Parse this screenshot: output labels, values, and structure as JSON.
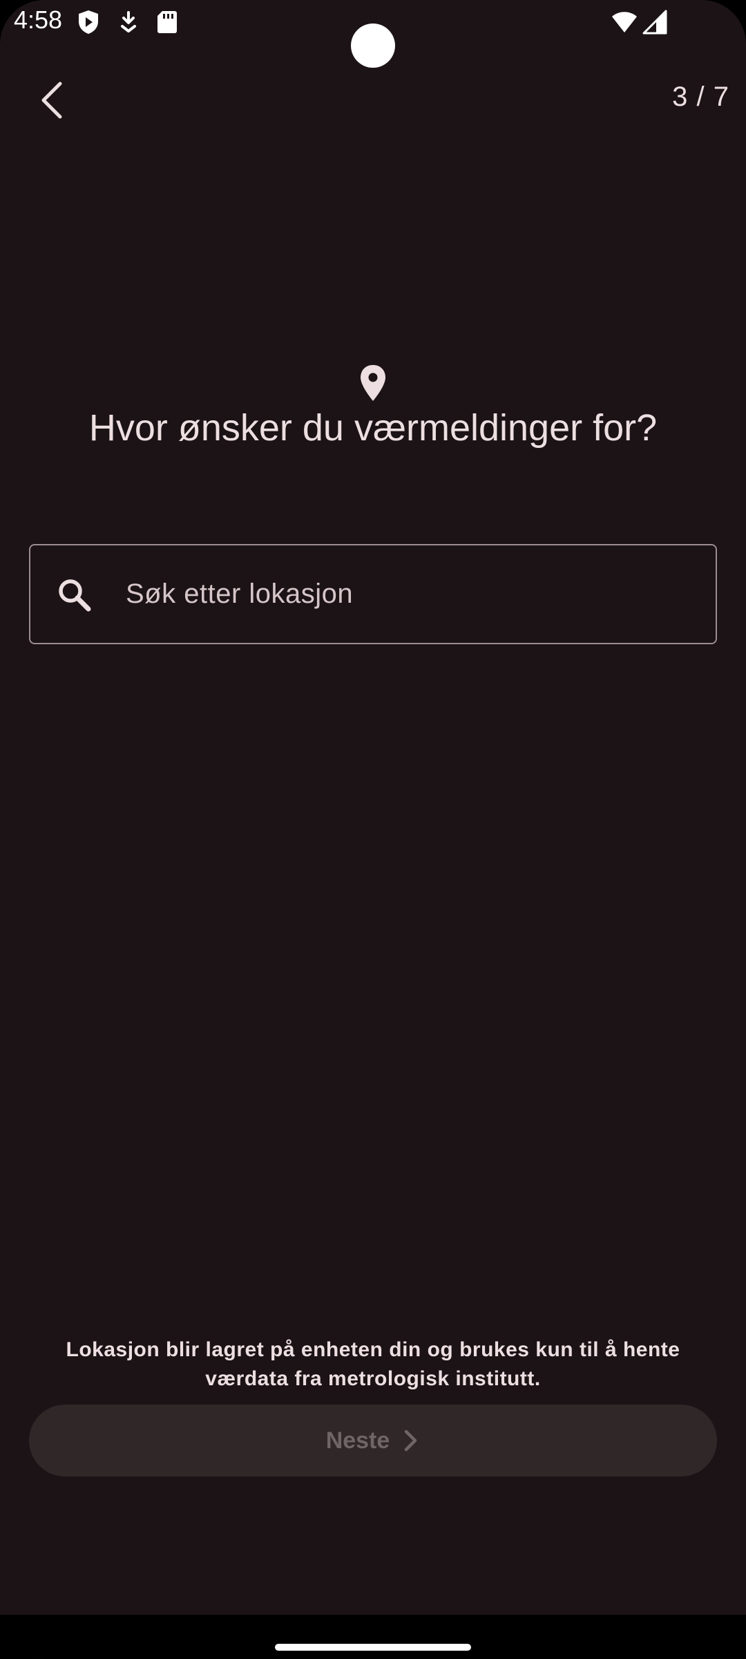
{
  "status_bar": {
    "time": "4:58",
    "left_icons": [
      "shield-play-icon",
      "download-icon",
      "sd-card-icon"
    ],
    "right_icons": [
      "wifi-icon",
      "signal-icon"
    ]
  },
  "header": {
    "back_icon": "chevron-left-icon",
    "step": "3 / 7"
  },
  "main": {
    "icon": "location-pin-icon",
    "title": "Hvor ønsker du værmeldinger for?",
    "search": {
      "icon": "search-icon",
      "placeholder": "Søk etter lokasjon",
      "value": ""
    }
  },
  "footer": {
    "info": "Lokasjon blir lagret på enheten din og brukes kun til å hente værdata fra metrologisk institutt.",
    "next_label": "Neste",
    "next_icon": "chevron-right-icon",
    "next_enabled": false
  },
  "colors": {
    "background": "#1b1316",
    "text": "#eddfe1",
    "button_disabled_bg": "#302729",
    "button_disabled_text": "#6f6466"
  }
}
